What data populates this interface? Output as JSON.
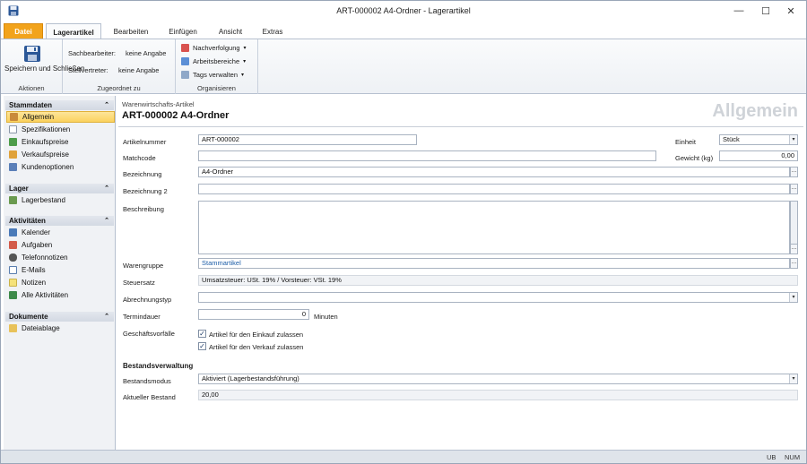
{
  "window": {
    "title": "ART-000002 A4-Ordner - Lagerartikel",
    "minimize": "—",
    "maximize": "☐",
    "close": "✕"
  },
  "ribbon_tabs": [
    "Datei",
    "Lagerartikel",
    "Bearbeiten",
    "Einfügen",
    "Ansicht",
    "Extras"
  ],
  "ribbon": {
    "actions": {
      "save_close": "Speichern und Schließen",
      "group_label": "Aktionen"
    },
    "assigned": {
      "clerk_label": "Sachbearbeiter:",
      "clerk_value": "keine Angabe",
      "deputy_label": "Stellvertreter:",
      "deputy_value": "keine Angabe",
      "group_label": "Zugeordnet zu"
    },
    "organize": {
      "tracking": "Nachverfolgung",
      "work_areas": "Arbeitsbereiche",
      "tags": "Tags verwalten",
      "group_label": "Organisieren"
    }
  },
  "nav": {
    "master": {
      "header": "Stammdaten",
      "items": [
        "Allgemein",
        "Spezifikationen",
        "Einkaufspreise",
        "Verkaufspreise",
        "Kundenoptionen"
      ]
    },
    "stock": {
      "header": "Lager",
      "items": [
        "Lagerbestand"
      ]
    },
    "activities": {
      "header": "Aktivitäten",
      "items": [
        "Kalender",
        "Aufgaben",
        "Telefonnotizen",
        "E-Mails",
        "Notizen",
        "Alle Aktivitäten"
      ]
    },
    "documents": {
      "header": "Dokumente",
      "items": [
        "Dateiablage"
      ]
    },
    "collapse_glyph": "⌃"
  },
  "content": {
    "breadcrumb": "Warenwirtschafts-Artikel",
    "record_title": "ART-000002 A4-Ordner",
    "watermark": "Allgemein",
    "fields": {
      "article_number": {
        "label": "Artikelnummer",
        "value": "ART-000002"
      },
      "matchcode": {
        "label": "Matchcode",
        "value": ""
      },
      "designation": {
        "label": "Bezeichnung",
        "value": "A4-Ordner"
      },
      "designation2": {
        "label": "Bezeichnung 2",
        "value": ""
      },
      "description": {
        "label": "Beschreibung",
        "value": ""
      },
      "unit": {
        "label": "Einheit",
        "value": "Stück"
      },
      "weight": {
        "label": "Gewicht (kg)",
        "value": "0,00"
      },
      "product_group": {
        "label": "Warengruppe",
        "value": "Stammartikel"
      },
      "tax_rate": {
        "label": "Steuersatz",
        "value": "Umsatzsteuer: USt. 19% / Vorsteuer: VSt. 19%"
      },
      "billing_type": {
        "label": "Abrechnungstyp",
        "value": ""
      },
      "duration": {
        "label": "Termindauer",
        "value": "0",
        "unit": "Minuten"
      },
      "transactions": {
        "label": "Geschäftsvorfälle",
        "purchase": "Artikel für den Einkauf zulassen",
        "sales": "Artikel für den Verkauf zulassen"
      }
    },
    "stock_section": {
      "header": "Bestandsverwaltung",
      "mode_label": "Bestandsmodus",
      "mode_value": "Aktiviert (Lagerbestandsführung)",
      "current_label": "Aktueller Bestand",
      "current_value": "20,00"
    }
  },
  "statusbar": {
    "ub": "UB",
    "num": "NUM"
  },
  "colors": {
    "file_tab": "#f2a31b",
    "selection": "#fbd25e",
    "link": "#1e5ea8"
  }
}
